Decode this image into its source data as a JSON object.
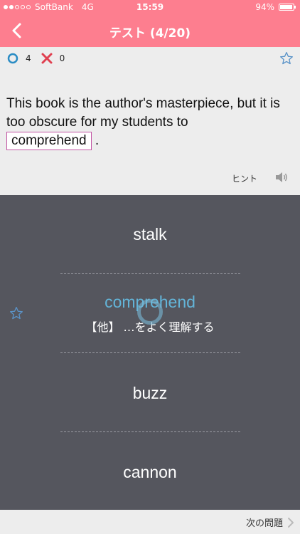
{
  "status": {
    "carrier": "SoftBank",
    "network": "4G",
    "time": "15:59",
    "battery": "94%",
    "battery_level": 0.94
  },
  "nav": {
    "title": "テスト (4/20)"
  },
  "score": {
    "correct": "4",
    "wrong": "0"
  },
  "question": {
    "text": "This book is the author's masterpiece, but it is too obscure for my students to",
    "answer": "comprehend",
    "end": "."
  },
  "hint_label": "ヒント",
  "choices": [
    {
      "word": "stalk"
    },
    {
      "word": "comprehend",
      "meaning": "【他】 …をよく理解する"
    },
    {
      "word": "buzz"
    },
    {
      "word": "cannon"
    }
  ],
  "next_label": "次の問題",
  "colors": {
    "accent_pink": "#fd7e8f",
    "correct_blue": "#2a8cc4",
    "wrong_red": "#e04050",
    "selected_blue": "#63b4d8"
  },
  "icons": [
    "back-chevron-icon",
    "star-icon",
    "circle-correct-icon",
    "cross-wrong-icon",
    "speaker-icon",
    "chevron-right-icon"
  ]
}
